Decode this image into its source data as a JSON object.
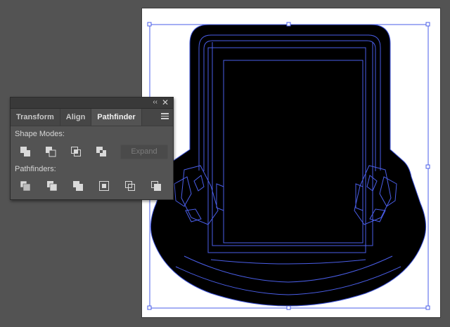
{
  "panel": {
    "collapse_glyph": "‹‹",
    "close_glyph": "✕",
    "tabs": [
      {
        "label": "Transform",
        "active": false
      },
      {
        "label": "Align",
        "active": false
      },
      {
        "label": "Pathfinder",
        "active": true
      }
    ],
    "shape_modes": {
      "label": "Shape Modes:",
      "icons": [
        "unite-icon",
        "minus-front-icon",
        "intersect-icon",
        "exclude-icon"
      ],
      "expand_label": "Expand"
    },
    "pathfinders": {
      "label": "Pathfinders:",
      "icons": [
        "divide-icon",
        "trim-icon",
        "merge-icon",
        "crop-icon",
        "outline-icon",
        "minus-back-icon"
      ]
    }
  },
  "colors": {
    "canvas_bg": "#535353",
    "artboard": "#ffffff",
    "selection": "#4a5ee8",
    "artwork_fill": "#000000"
  }
}
